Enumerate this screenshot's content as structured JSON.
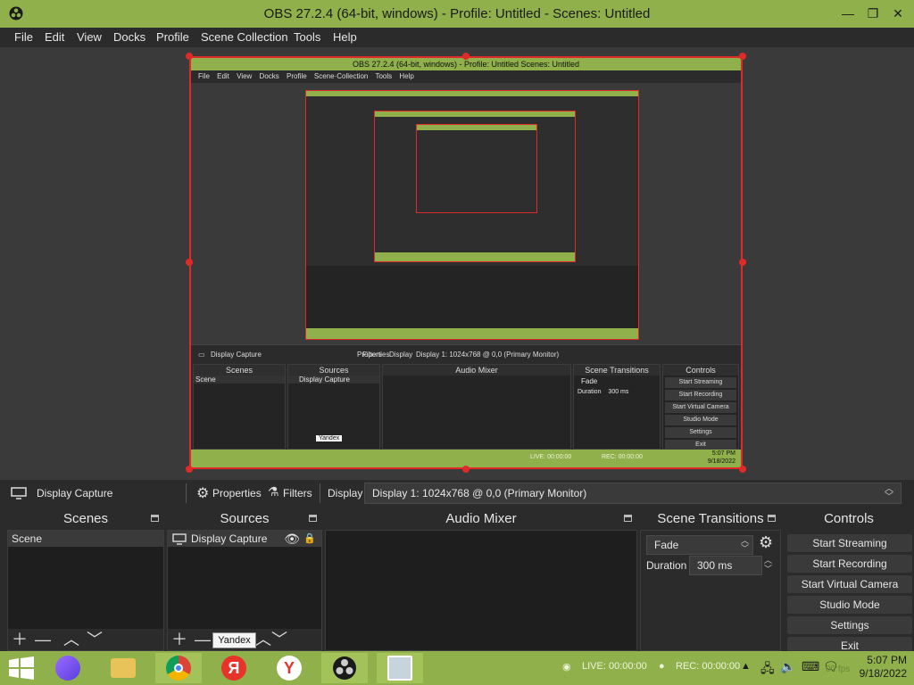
{
  "window": {
    "title": "OBS 27.2.4 (64-bit, windows) - Profile: Untitled - Scenes: Untitled",
    "minimize_glyph": "—",
    "restore_glyph": "❐",
    "close_glyph": "✕"
  },
  "menu": [
    "File",
    "Edit",
    "View",
    "Docks",
    "Profile",
    "Scene Collection",
    "Tools",
    "Help"
  ],
  "capture_preview": {
    "title": "OBS 27.2.4 (64-bit, windows) - Profile: Untitled   Scenes: Untitled",
    "menu": "File Edit View Docks Profile Scene·Collection Tools Help",
    "source_label": "Display Capture",
    "properties": "Properties",
    "filters": "Filters",
    "display_label": "Display",
    "display_value": "Display 1: 1024x768 @ 0,0 (Primary Monitor)",
    "docks": [
      "Scenes",
      "Sources",
      "Audio Mixer",
      "Scene Transitions",
      "Controls"
    ],
    "scene_item": "Scene",
    "source_item": "Display Capture",
    "transition": "Fade",
    "duration_label": "Duration",
    "duration_value": "300 ms",
    "controls": [
      "Start Streaming",
      "Start Recording",
      "Start Virtual Camera",
      "Studio Mode",
      "Settings",
      "Exit"
    ],
    "tooltip": "Yandex",
    "live": "LIVE: 00:00:00",
    "rec": "REC: 00:00:00",
    "time": "5:07 PM",
    "date": "9/18/2022"
  },
  "props_bar": {
    "source_name": "Display Capture",
    "properties_label": "Properties",
    "filters_label": "Filters",
    "display_label": "Display",
    "display_value": "Display 1: 1024x768 @ 0,0 (Primary Monitor)"
  },
  "docks": {
    "scenes": {
      "title": "Scenes",
      "items": [
        "Scene"
      ]
    },
    "sources": {
      "title": "Sources",
      "items": [
        "Display Capture"
      ]
    },
    "audio_mixer": {
      "title": "Audio Mixer"
    },
    "transitions": {
      "title": "Scene Transitions",
      "transition": "Fade",
      "duration_label": "Duration",
      "duration_value": "300 ms"
    },
    "controls": {
      "title": "Controls",
      "buttons": [
        "Start Streaming",
        "Start Recording",
        "Start Virtual Camera",
        "Studio Mode",
        "Settings",
        "Exit"
      ]
    }
  },
  "tooltip": "Yandex",
  "taskbar": {
    "live": "LIVE: 00:00:00",
    "rec": "REC: 00:00:00",
    "fps_fragment": "00 fps",
    "time": "5:07 PM",
    "date": "9/18/2022",
    "yandex_letter": "Я"
  },
  "colors": {
    "accent_green": "#8fb04a",
    "selection_red": "#e02a2a",
    "panel_dark": "#1e1e1e"
  }
}
